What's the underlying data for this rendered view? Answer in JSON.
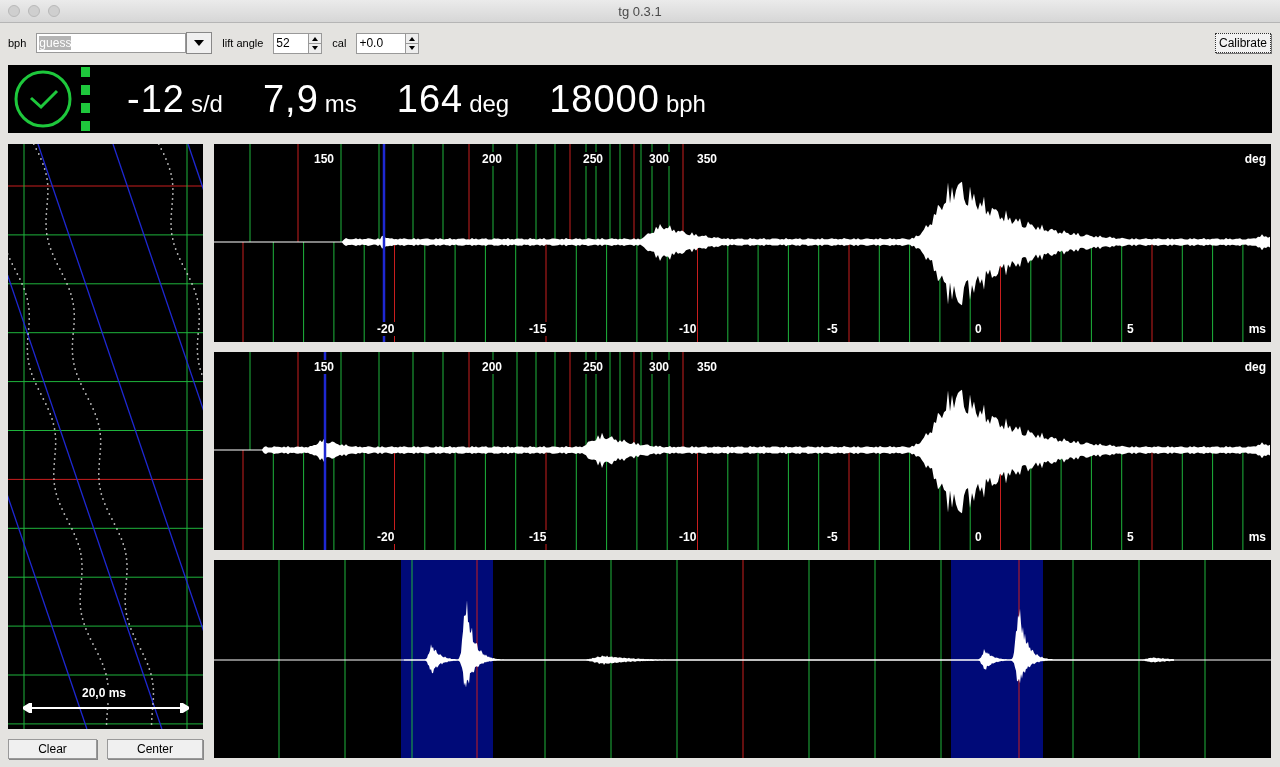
{
  "window": {
    "title": "tg 0.3.1"
  },
  "toolbar": {
    "bph": {
      "label": "bph",
      "value": "guess"
    },
    "lift_angle": {
      "label": "lift angle",
      "value": "52"
    },
    "cal": {
      "label": "cal",
      "value": "+0.0"
    },
    "calibrate_button": "Calibrate"
  },
  "readout": [
    {
      "value": "-12",
      "unit": "s/d"
    },
    {
      "value": "7,9",
      "unit": "ms"
    },
    {
      "value": "164",
      "unit": "deg"
    },
    {
      "value": "18000",
      "unit": "bph"
    }
  ],
  "paperstrip": {
    "scale_label": "20,0 ms",
    "buttons": [
      "Clear",
      "Center"
    ]
  },
  "waveforms": [
    {
      "deg_ticks": [
        "150",
        "200",
        "250",
        "300",
        "350"
      ],
      "deg_unit": "deg",
      "ms_ticks": [
        "-20",
        "-15",
        "-10",
        "-5",
        "0",
        "5"
      ],
      "ms_unit": "ms"
    },
    {
      "deg_ticks": [
        "150",
        "200",
        "250",
        "300",
        "350"
      ],
      "deg_unit": "deg",
      "ms_ticks": [
        "-20",
        "-15",
        "-10",
        "-5",
        "0",
        "5"
      ],
      "ms_unit": "ms"
    }
  ]
}
